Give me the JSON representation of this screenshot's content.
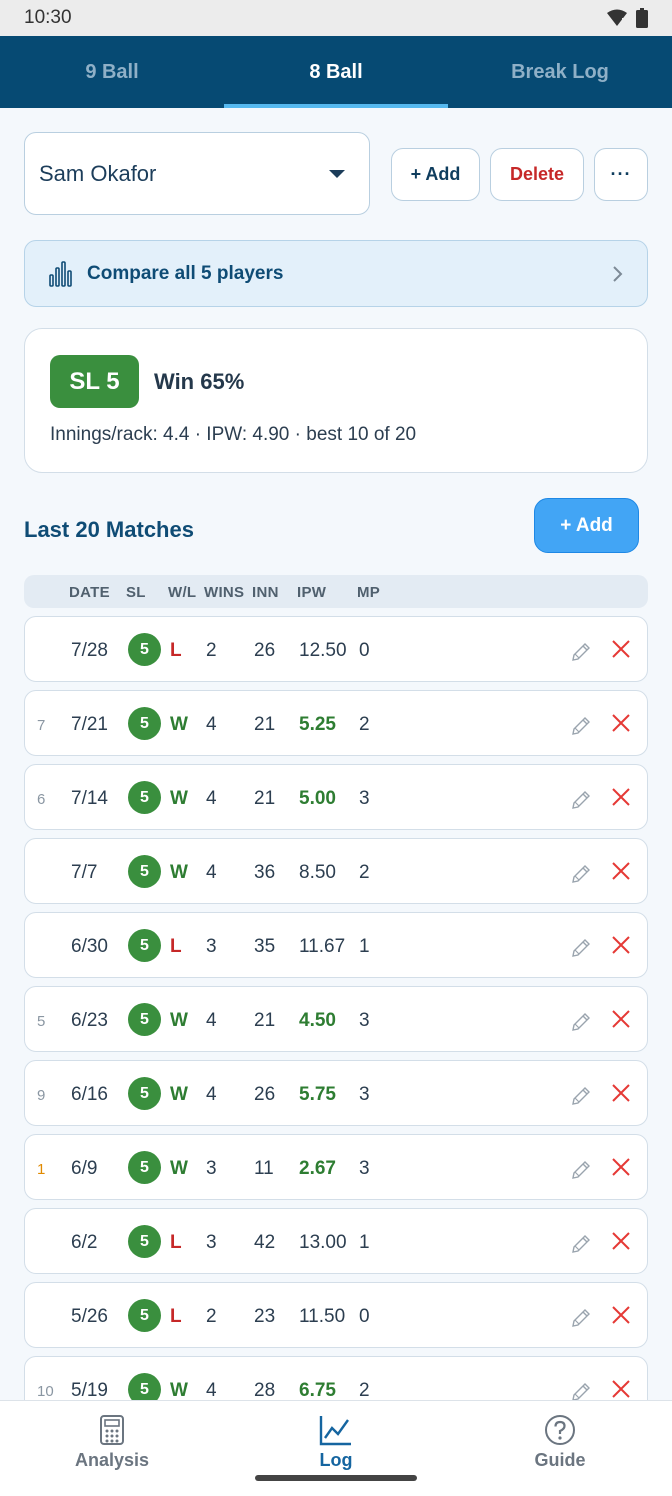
{
  "status_bar": {
    "time": "10:30"
  },
  "tabs": [
    {
      "label": "9 Ball",
      "active": false
    },
    {
      "label": "8 Ball",
      "active": true
    },
    {
      "label": "Break Log",
      "active": false
    }
  ],
  "player_selector": {
    "selected": "Sam Okafor"
  },
  "actions": {
    "add_label": "+ Add",
    "delete_label": "Delete",
    "more_label": "···"
  },
  "compare": {
    "label": "Compare all 5 players"
  },
  "summary": {
    "skill_level": "SL 5",
    "win_pct": "Win 65%",
    "stats_line": "Innings/rack: 4.4 · IPW: 4.90 · best 10 of 20"
  },
  "matches_section": {
    "title": "Last 20 Matches",
    "add_label": "+ Add"
  },
  "table": {
    "headers": {
      "date": "DATE",
      "sl": "SL",
      "wl": "W/L",
      "wins": "WINS",
      "inn": "INN",
      "ipw": "IPW",
      "mp": "MP"
    },
    "rows": [
      {
        "rank": "",
        "date": "7/28",
        "sl": "5",
        "wl": "L",
        "wins": "2",
        "inn": "26",
        "ipw": "12.50",
        "mp": "0",
        "ipw_good": false,
        "gold": false
      },
      {
        "rank": "7",
        "date": "7/21",
        "sl": "5",
        "wl": "W",
        "wins": "4",
        "inn": "21",
        "ipw": "5.25",
        "mp": "2",
        "ipw_good": true,
        "gold": false
      },
      {
        "rank": "6",
        "date": "7/14",
        "sl": "5",
        "wl": "W",
        "wins": "4",
        "inn": "21",
        "ipw": "5.00",
        "mp": "3",
        "ipw_good": true,
        "gold": false
      },
      {
        "rank": "",
        "date": "7/7",
        "sl": "5",
        "wl": "W",
        "wins": "4",
        "inn": "36",
        "ipw": "8.50",
        "mp": "2",
        "ipw_good": false,
        "gold": false
      },
      {
        "rank": "",
        "date": "6/30",
        "sl": "5",
        "wl": "L",
        "wins": "3",
        "inn": "35",
        "ipw": "11.67",
        "mp": "1",
        "ipw_good": false,
        "gold": false
      },
      {
        "rank": "5",
        "date": "6/23",
        "sl": "5",
        "wl": "W",
        "wins": "4",
        "inn": "21",
        "ipw": "4.50",
        "mp": "3",
        "ipw_good": true,
        "gold": false
      },
      {
        "rank": "9",
        "date": "6/16",
        "sl": "5",
        "wl": "W",
        "wins": "4",
        "inn": "26",
        "ipw": "5.75",
        "mp": "3",
        "ipw_good": true,
        "gold": false
      },
      {
        "rank": "1",
        "date": "6/9",
        "sl": "5",
        "wl": "W",
        "wins": "3",
        "inn": "11",
        "ipw": "2.67",
        "mp": "3",
        "ipw_good": true,
        "gold": true
      },
      {
        "rank": "",
        "date": "6/2",
        "sl": "5",
        "wl": "L",
        "wins": "3",
        "inn": "42",
        "ipw": "13.00",
        "mp": "1",
        "ipw_good": false,
        "gold": false
      },
      {
        "rank": "",
        "date": "5/26",
        "sl": "5",
        "wl": "L",
        "wins": "2",
        "inn": "23",
        "ipw": "11.50",
        "mp": "0",
        "ipw_good": false,
        "gold": false
      },
      {
        "rank": "10",
        "date": "5/19",
        "sl": "5",
        "wl": "W",
        "wins": "4",
        "inn": "28",
        "ipw": "6.75",
        "mp": "2",
        "ipw_good": true,
        "gold": false
      }
    ]
  },
  "bottom_nav": [
    {
      "label": "Analysis",
      "icon": "calculator-icon",
      "active": false
    },
    {
      "label": "Log",
      "icon": "line-chart-icon",
      "active": true
    },
    {
      "label": "Guide",
      "icon": "help-circle-icon",
      "active": false
    }
  ],
  "colors": {
    "header": "#064a73",
    "win": "#2e7d32",
    "loss": "#c62828",
    "accent": "#42a5f5",
    "badge": "#3a8f3e"
  }
}
